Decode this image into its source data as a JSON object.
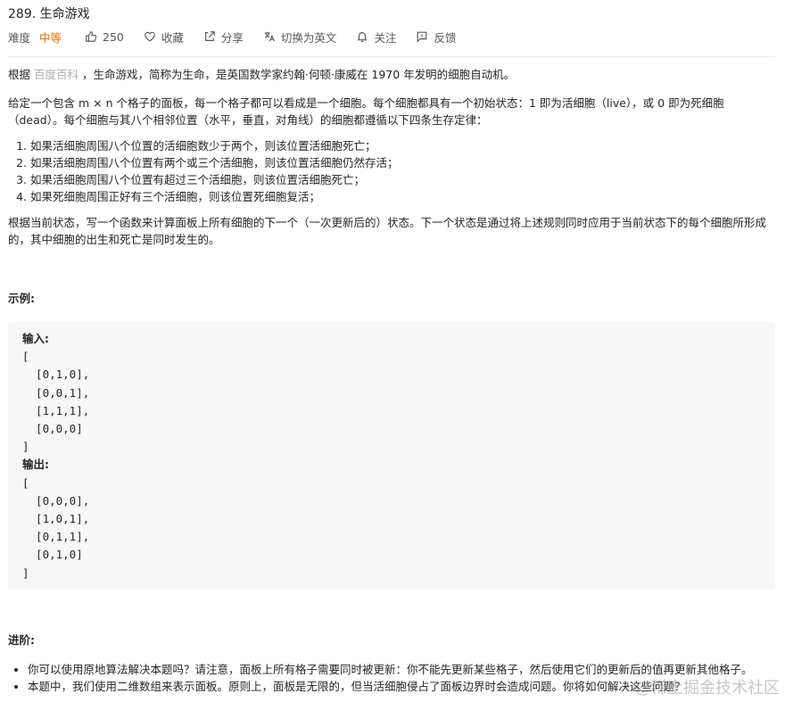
{
  "problem": {
    "title": "289. 生命游戏",
    "difficulty_label": "难度",
    "difficulty_value": "中等",
    "likes": "250",
    "favorite_label": "收藏",
    "share_label": "分享",
    "translate_label": "切换为英文",
    "follow_label": "关注",
    "feedback_label": "反馈"
  },
  "description": {
    "intro_prefix": "根据 ",
    "intro_link": "百度百科",
    "intro_suffix": " ，生命游戏，简称为生命，是英国数学家约翰·何顿·康威在 1970 年发明的细胞自动机。",
    "para2": "给定一个包含 m × n 个格子的面板，每一个格子都可以看成是一个细胞。每个细胞都具有一个初始状态：1 即为活细胞（live），或 0 即为死细胞（dead）。每个细胞与其八个相邻位置（水平，垂直，对角线）的细胞都遵循以下四条生存定律：",
    "rules": [
      "如果活细胞周围八个位置的活细胞数少于两个，则该位置活细胞死亡；",
      "如果活细胞周围八个位置有两个或三个活细胞，则该位置活细胞仍然存活；",
      "如果活细胞周围八个位置有超过三个活细胞，则该位置活细胞死亡；",
      "如果死细胞周围正好有三个活细胞，则该位置死细胞复活；"
    ],
    "para3": "根据当前状态，写一个函数来计算面板上所有细胞的下一个（一次更新后的）状态。下一个状态是通过将上述规则同时应用于当前状态下的每个细胞所形成的，其中细胞的出生和死亡是同时发生的。"
  },
  "example": {
    "heading": "示例:",
    "input_label": "输入:",
    "input_lines": [
      "[",
      "  [0,1,0],",
      "  [0,0,1],",
      "  [1,1,1],",
      "  [0,0,0]",
      "]"
    ],
    "output_label": "输出:",
    "output_lines": [
      "[",
      "  [0,0,0],",
      "  [1,0,1],",
      "  [0,1,1],",
      "  [0,1,0]",
      "]"
    ]
  },
  "advanced": {
    "heading": "进阶:",
    "items": [
      "你可以使用原地算法解决本题吗？请注意，面板上所有格子需要同时被更新：你不能先更新某些格子，然后使用它们的更新后的值再更新其他格子。",
      "本题中，我们使用二维数组来表示面板。原则上，面板是无限的，但当活细胞侵占了面板边界时会造成问题。你将如何解决这些问题？"
    ]
  },
  "watermark": "@稀土掘金技术社区",
  "icons": {
    "like": "thumbs-up-icon",
    "favorite": "heart-icon",
    "share": "share-icon",
    "translate": "translate-icon",
    "follow": "bell-icon",
    "feedback": "feedback-icon"
  },
  "colors": {
    "difficulty_medium": "#ef6c00",
    "link": "#b0b0b0",
    "code_bg": "#f7f7f7"
  }
}
